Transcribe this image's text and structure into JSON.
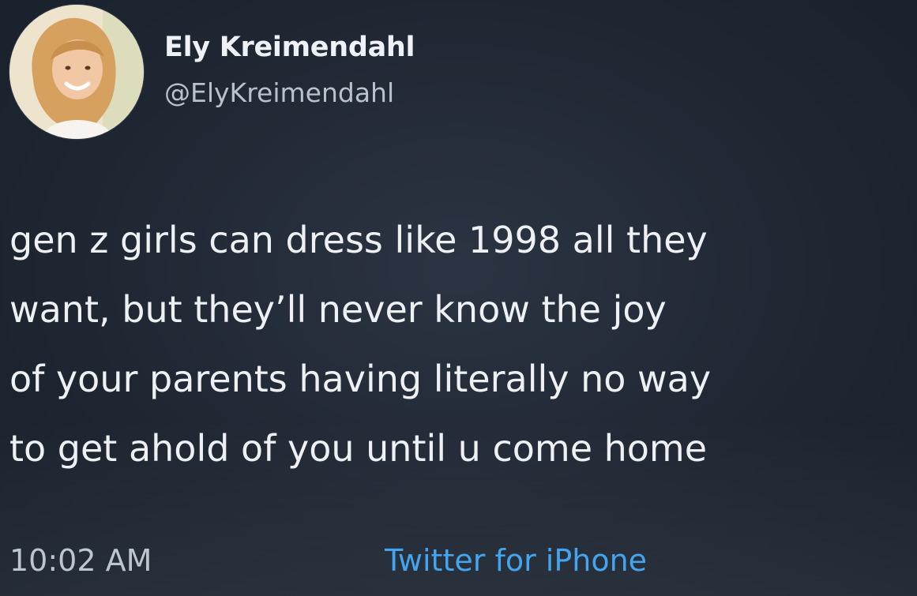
{
  "author": {
    "name": "Ely Kreimendahl",
    "handle": "@ElyKreimendahl"
  },
  "tweet": {
    "lines": [
      "gen z girls can dress like 1998 all they",
      "want, but they’ll never know the joy",
      "of your parents having literally no way",
      "to get ahold of you until u come home"
    ],
    "time": "10:02 AM",
    "source": "Twitter for iPhone"
  },
  "colors": {
    "background": "#1f2733",
    "text": "#eef1f4",
    "muted_text": "#b9c3cd",
    "link": "#3aa0ee"
  },
  "icons": {
    "avatar": "profile-photo"
  }
}
